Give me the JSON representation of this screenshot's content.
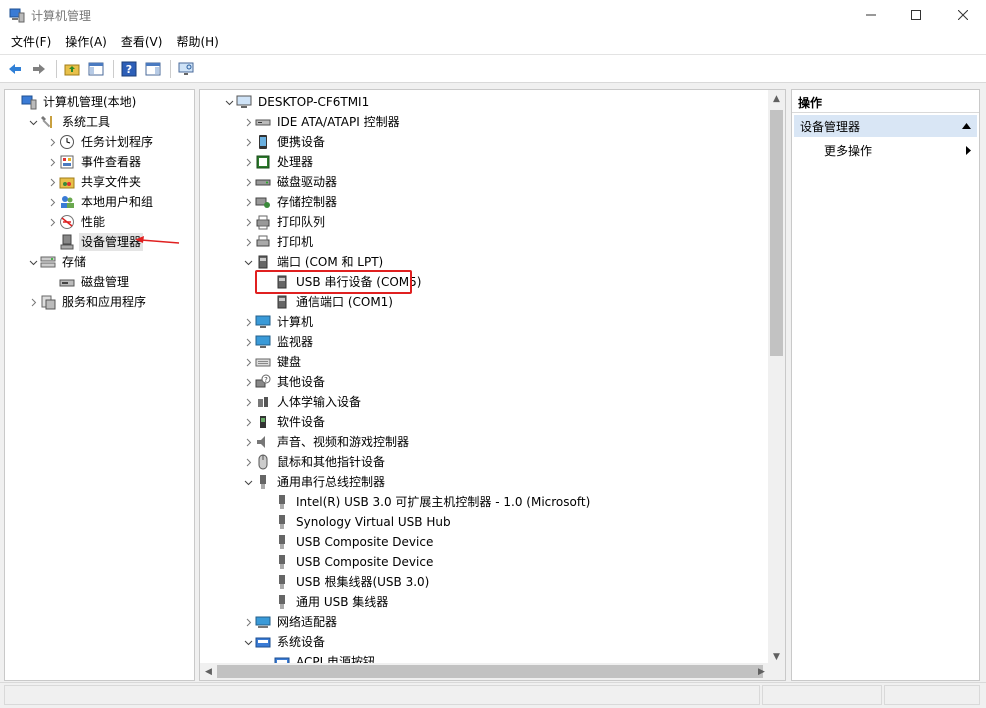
{
  "window": {
    "title": "计算机管理"
  },
  "menu": [
    "文件(F)",
    "操作(A)",
    "查看(V)",
    "帮助(H)"
  ],
  "left_tree": [
    {
      "label": "计算机管理(本地)",
      "level": 0,
      "expander": "",
      "icon": "computer-management-icon"
    },
    {
      "label": "系统工具",
      "level": 1,
      "expander": "open",
      "icon": "tools-icon"
    },
    {
      "label": "任务计划程序",
      "level": 2,
      "expander": "closed",
      "icon": "clock-icon"
    },
    {
      "label": "事件查看器",
      "level": 2,
      "expander": "closed",
      "icon": "event-viewer-icon"
    },
    {
      "label": "共享文件夹",
      "level": 2,
      "expander": "closed",
      "icon": "shared-folder-icon"
    },
    {
      "label": "本地用户和组",
      "level": 2,
      "expander": "closed",
      "icon": "users-icon"
    },
    {
      "label": "性能",
      "level": 2,
      "expander": "closed",
      "icon": "performance-icon"
    },
    {
      "label": "设备管理器",
      "level": 2,
      "expander": "",
      "icon": "device-manager-icon",
      "selected": true
    },
    {
      "label": "存储",
      "level": 1,
      "expander": "open",
      "icon": "storage-icon"
    },
    {
      "label": "磁盘管理",
      "level": 2,
      "expander": "",
      "icon": "disk-icon"
    },
    {
      "label": "服务和应用程序",
      "level": 1,
      "expander": "closed",
      "icon": "services-icon"
    }
  ],
  "device_tree": [
    {
      "label": "DESKTOP-CF6TMI1",
      "level": 0,
      "expander": "open",
      "icon": "computer-icon"
    },
    {
      "label": "IDE ATA/ATAPI 控制器",
      "level": 1,
      "expander": "closed",
      "icon": "ide-controller-icon"
    },
    {
      "label": "便携设备",
      "level": 1,
      "expander": "closed",
      "icon": "portable-device-icon"
    },
    {
      "label": "处理器",
      "level": 1,
      "expander": "closed",
      "icon": "processor-icon"
    },
    {
      "label": "磁盘驱动器",
      "level": 1,
      "expander": "closed",
      "icon": "disk-drive-icon"
    },
    {
      "label": "存储控制器",
      "level": 1,
      "expander": "closed",
      "icon": "storage-controller-icon"
    },
    {
      "label": "打印队列",
      "level": 1,
      "expander": "closed",
      "icon": "print-queue-icon"
    },
    {
      "label": "打印机",
      "level": 1,
      "expander": "closed",
      "icon": "printer-icon"
    },
    {
      "label": "端口 (COM 和 LPT)",
      "level": 1,
      "expander": "open",
      "icon": "port-icon"
    },
    {
      "label": "USB 串行设备 (COM5)",
      "level": 2,
      "expander": "",
      "icon": "port-icon",
      "highlighted": true
    },
    {
      "label": "通信端口 (COM1)",
      "level": 2,
      "expander": "",
      "icon": "port-icon"
    },
    {
      "label": "计算机",
      "level": 1,
      "expander": "closed",
      "icon": "monitor-icon"
    },
    {
      "label": "监视器",
      "level": 1,
      "expander": "closed",
      "icon": "monitor-icon"
    },
    {
      "label": "键盘",
      "level": 1,
      "expander": "closed",
      "icon": "keyboard-icon"
    },
    {
      "label": "其他设备",
      "level": 1,
      "expander": "closed",
      "icon": "unknown-device-icon"
    },
    {
      "label": "人体学输入设备",
      "level": 1,
      "expander": "closed",
      "icon": "hid-icon"
    },
    {
      "label": "软件设备",
      "level": 1,
      "expander": "closed",
      "icon": "software-device-icon"
    },
    {
      "label": "声音、视频和游戏控制器",
      "level": 1,
      "expander": "closed",
      "icon": "speaker-icon"
    },
    {
      "label": "鼠标和其他指针设备",
      "level": 1,
      "expander": "closed",
      "icon": "mouse-icon"
    },
    {
      "label": "通用串行总线控制器",
      "level": 1,
      "expander": "open",
      "icon": "usb-icon"
    },
    {
      "label": "Intel(R) USB 3.0 可扩展主机控制器 - 1.0 (Microsoft)",
      "level": 2,
      "expander": "",
      "icon": "usb-icon"
    },
    {
      "label": "Synology Virtual USB Hub",
      "level": 2,
      "expander": "",
      "icon": "usb-icon"
    },
    {
      "label": "USB Composite Device",
      "level": 2,
      "expander": "",
      "icon": "usb-icon"
    },
    {
      "label": "USB Composite Device",
      "level": 2,
      "expander": "",
      "icon": "usb-icon"
    },
    {
      "label": "USB 根集线器(USB 3.0)",
      "level": 2,
      "expander": "",
      "icon": "usb-icon"
    },
    {
      "label": "通用 USB 集线器",
      "level": 2,
      "expander": "",
      "icon": "usb-icon"
    },
    {
      "label": "网络适配器",
      "level": 1,
      "expander": "closed",
      "icon": "network-adapter-icon"
    },
    {
      "label": "系统设备",
      "level": 1,
      "expander": "open",
      "icon": "system-device-icon"
    },
    {
      "label": "ACPI 电源按钮",
      "level": 2,
      "expander": "",
      "icon": "system-device-icon"
    }
  ],
  "actions": {
    "header": "操作",
    "group": "设备管理器",
    "item": "更多操作"
  },
  "colors": {
    "highlight": "#e02020",
    "selection": "#e5e5e5",
    "action_group_bg": "#d9e6f5"
  }
}
